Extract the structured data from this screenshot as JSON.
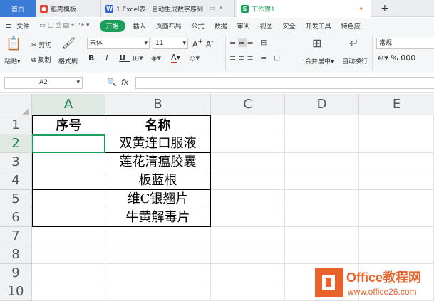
{
  "tabs": {
    "home": "首页",
    "template": "稻壳模板",
    "excel": "1.Excel表...自动生成数字序列",
    "book": "工作簿1",
    "add": "+"
  },
  "menu": {
    "file": "文件",
    "items": [
      "开始",
      "插入",
      "页面布局",
      "公式",
      "数据",
      "审阅",
      "视图",
      "安全",
      "开发工具",
      "特色应"
    ]
  },
  "ribbon": {
    "cut": "剪切",
    "copy": "复制",
    "paste": "粘贴",
    "format_painter": "格式刷",
    "font_name": "宋体",
    "font_size": "11",
    "merge": "合并居中",
    "wrap": "自动换行",
    "number_format": "常规",
    "percent": "%",
    "thousands": "000"
  },
  "formula_bar": {
    "name_box": "A2",
    "fx": "fx",
    "value": ""
  },
  "columns": [
    "A",
    "B",
    "C",
    "D",
    "E"
  ],
  "rows": [
    "1",
    "2",
    "3",
    "4",
    "5",
    "6",
    "7",
    "8",
    "9",
    "10"
  ],
  "cells": {
    "A1": "序号",
    "B1": "名称",
    "B2": "双黄连口服液",
    "B3": "莲花清瘟胶囊",
    "B4": "板蓝根",
    "B5": "维C银翘片",
    "B6": "牛黄解毒片"
  },
  "watermark": {
    "brand_prefix": "Office",
    "brand_suffix": "教程网",
    "url": "www.office26.com"
  },
  "colors": {
    "accent": "#1aa05a",
    "home_tab": "#3a7bd5",
    "watermark_orange": "#e8622a"
  }
}
